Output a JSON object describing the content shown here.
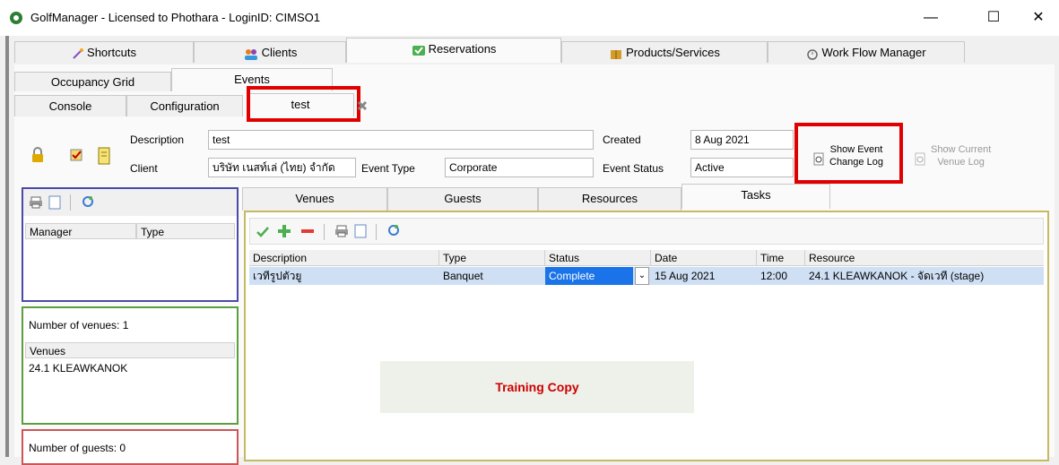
{
  "window": {
    "title": "GolfManager - Licensed to Phothara - LoginID: CIMSO1",
    "controls": {
      "minimize": "—",
      "maximize": "☐",
      "close": "✕"
    }
  },
  "main_tabs": [
    "Shortcuts",
    "Clients",
    "Reservations",
    "Products/Services",
    "Work Flow Manager"
  ],
  "sub_tabs": [
    "Occupancy Grid",
    "Events"
  ],
  "event_tabs": [
    "Console",
    "Configuration",
    "test"
  ],
  "form": {
    "description_label": "Description",
    "description_value": "test",
    "client_label": "Client",
    "client_value": "บริษัท เนสท์เล่ (ไทย) จำกัด",
    "event_type_label": "Event Type",
    "event_type_value": "Corporate",
    "created_label": "Created",
    "created_value": "8 Aug 2021",
    "event_status_label": "Event Status",
    "event_status_value": "Active",
    "show_event_change_log": [
      "Show Event",
      "Change Log"
    ],
    "show_current_venue_log": [
      "Show Current",
      "Venue Log"
    ]
  },
  "left": {
    "manager_col": "Manager",
    "type_col": "Type",
    "venues_count": "Number of venues: 1",
    "venues_header": "Venues",
    "venues": [
      "24.1 KLEAWKANOK"
    ],
    "guests_count": "Number of guests: 0"
  },
  "detail_tabs": [
    "Venues",
    "Guests",
    "Resources",
    "Tasks"
  ],
  "tasks": {
    "columns": [
      "Description",
      "Type",
      "Status",
      "Date",
      "Time",
      "Resource"
    ],
    "rows": [
      {
        "description": "เวทีรูปตัวยู",
        "type": "Banquet",
        "status": "Complete",
        "date": "15 Aug 2021",
        "time": "12:00",
        "resource": "24.1 KLEAWKANOK - จัดเวที (stage)"
      }
    ]
  },
  "watermark": "Training Copy",
  "colors": {
    "highlight": "#e00000",
    "accent_green": "#4caf50",
    "accent_red": "#e53935",
    "selection": "#cfe0f5",
    "watermark_text": "#cc0000"
  }
}
